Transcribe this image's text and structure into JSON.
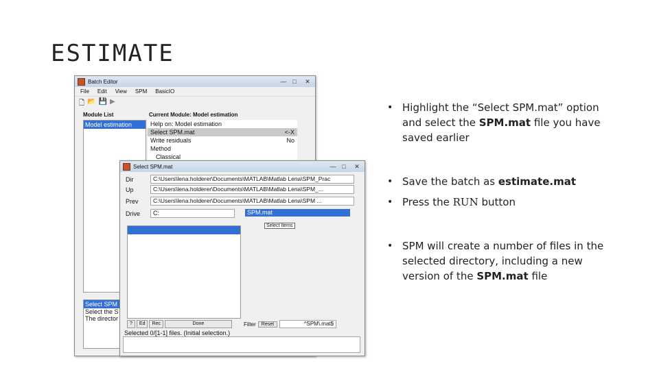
{
  "slide": {
    "title": "ESTIMATE"
  },
  "batch_editor": {
    "title": "Batch Editor",
    "menu": [
      "File",
      "Edit",
      "View",
      "SPM",
      "BasicIO"
    ],
    "module_list_label": "Module List",
    "current_module_label": "Current Module: Model estimation",
    "module_selected": "Model estimation",
    "options": [
      {
        "label": "Help on: Model estimation",
        "value": ""
      },
      {
        "label": "Select SPM.mat",
        "value": "<-X"
      },
      {
        "label": "Write residuals",
        "value": "No"
      },
      {
        "label": "Method",
        "value": ""
      },
      {
        "label": "  Classical",
        "value": ""
      }
    ],
    "desc_lines": [
      "Select SPM",
      "Select the S",
      "The director"
    ]
  },
  "select_dialog": {
    "title": "Select SPM.mat",
    "rows": [
      {
        "label": "Dir",
        "path": "C:\\Users\\lena.holderer\\Documents\\MATLAB\\Matlab Lena\\SPM_Prac"
      },
      {
        "label": "Up",
        "path": "C:\\Users\\lena.holderer\\Documents\\MATLAB\\Matlab Lena\\SPM_..."
      },
      {
        "label": "Prev",
        "path": "C:\\Users\\lena.holderer\\Documents\\MATLAB\\Matlab Lena\\SPM ..."
      }
    ],
    "drive_label": "Drive",
    "drive_value": "C:",
    "selected_file": "SPM.mat",
    "select_items": "Select Items",
    "bottom_buttons": [
      "?",
      "Ed",
      "Rec",
      "Done"
    ],
    "filter_label": "Filter",
    "reset_label": "Reset",
    "filter_value": "^SPM\\.mat$",
    "status": "Selected 0/[1-1] files. (Initial selection.)"
  },
  "bullets": [
    {
      "parts": [
        {
          "t": "Highlight the “Select SPM.mat” option and select the ",
          "s": ""
        },
        {
          "t": "SPM.mat",
          "s": "b"
        },
        {
          "t": " file you have saved earlier",
          "s": ""
        }
      ]
    },
    {
      "parts": [
        {
          "t": "Save the batch as ",
          "s": ""
        },
        {
          "t": "estimate.mat",
          "s": "b"
        }
      ]
    },
    {
      "parts": [
        {
          "t": "Press the ",
          "s": ""
        },
        {
          "t": "RUN",
          "s": "m"
        },
        {
          "t": " button",
          "s": ""
        }
      ]
    },
    {
      "parts": [
        {
          "t": "SPM will create a number of files in the selected directory, including a new version of the ",
          "s": ""
        },
        {
          "t": "SPM.mat",
          "s": "b"
        },
        {
          "t": " file",
          "s": ""
        }
      ]
    }
  ]
}
